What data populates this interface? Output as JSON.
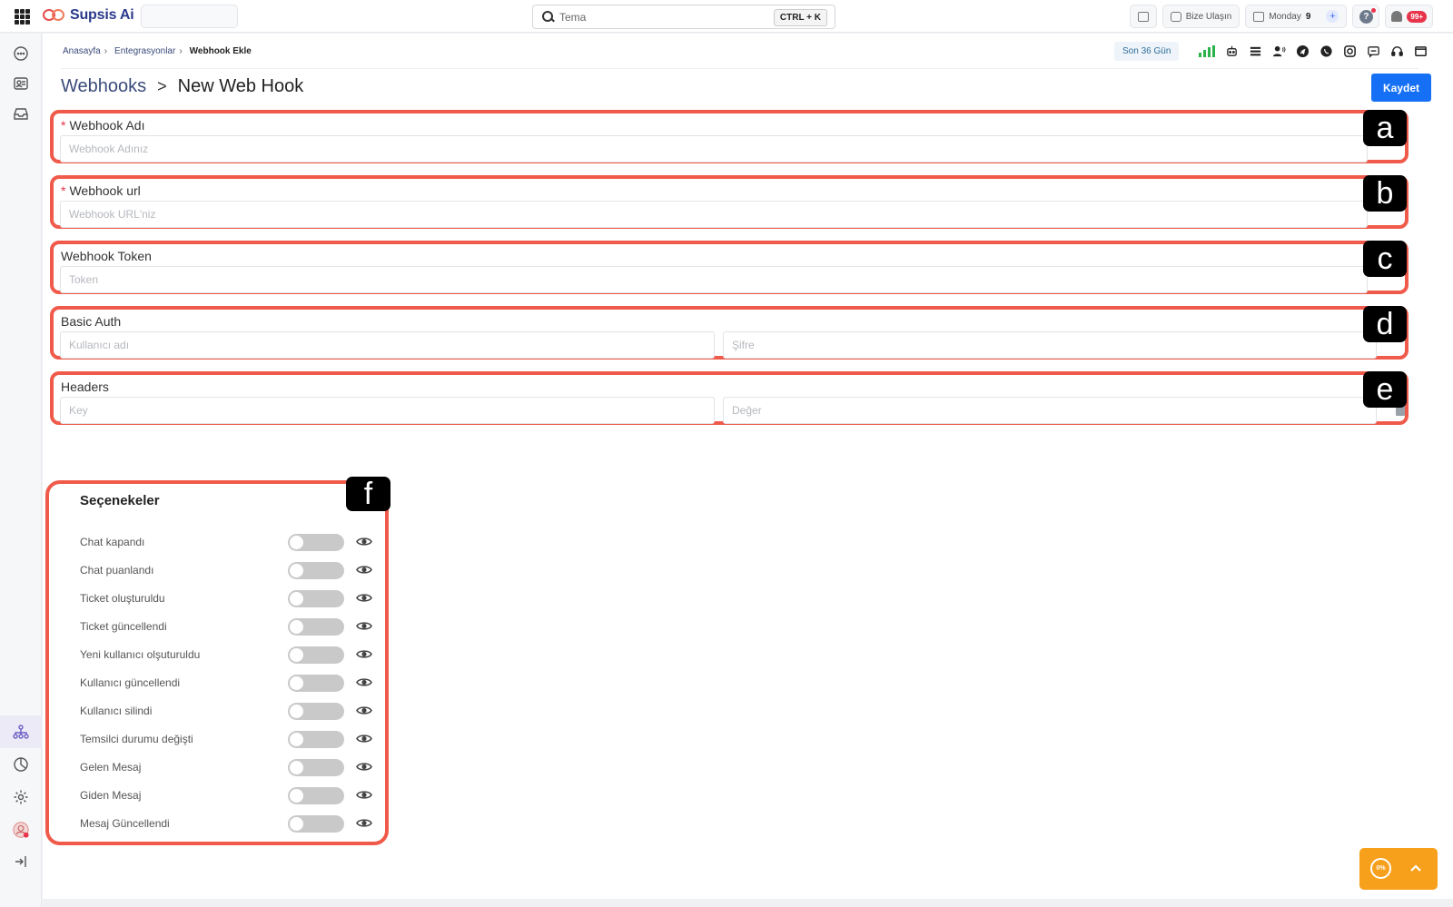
{
  "app": {
    "name": "Supsis Ai"
  },
  "search": {
    "value": "Tema",
    "shortcut": "CTRL + K"
  },
  "topbar": {
    "contact_label": "Bize Ulaşın",
    "date_day": "Monday",
    "date_num": "9",
    "notif_count": "99+",
    "help": "?"
  },
  "breadcrumb": {
    "items": [
      "Anasayfa",
      "Entegrasyonlar",
      "Webhook Ekle"
    ],
    "separator": "›"
  },
  "toolbar": {
    "period": "Son 36 Gün"
  },
  "page": {
    "parent": "Webhooks",
    "chevron": ">",
    "title": "New Web Hook",
    "save_label": "Kaydet"
  },
  "form": {
    "name": {
      "required": "*",
      "label": "Webhook Adı",
      "placeholder": "Webhook Adınız",
      "tag": "a"
    },
    "url": {
      "required": "*",
      "label": "Webhook url",
      "placeholder": "Webhook URL'niz",
      "tag": "b"
    },
    "token": {
      "label": "Webhook Token",
      "placeholder": "Token",
      "tag": "c"
    },
    "auth": {
      "label": "Basic Auth",
      "user_placeholder": "Kullanıcı adı",
      "pass_placeholder": "Şifre",
      "tag": "d"
    },
    "headers": {
      "label": "Headers",
      "key_placeholder": "Key",
      "value_placeholder": "Değer",
      "tag": "e"
    }
  },
  "options": {
    "title": "Seçenekeler",
    "tag": "f",
    "items": [
      {
        "label": "Chat kapandı",
        "enabled": false
      },
      {
        "label": "Chat puanlandı",
        "enabled": false
      },
      {
        "label": "Ticket oluşturuldu",
        "enabled": false
      },
      {
        "label": "Ticket güncellendi",
        "enabled": false
      },
      {
        "label": "Yeni kullanıcı olşuturuldu",
        "enabled": false
      },
      {
        "label": "Kullanıcı güncellendi",
        "enabled": false
      },
      {
        "label": "Kullanıcı silindi",
        "enabled": false
      },
      {
        "label": "Temsilci durumu değişti",
        "enabled": false
      },
      {
        "label": "Gelen Mesaj",
        "enabled": false
      },
      {
        "label": "Giden Mesaj",
        "enabled": false
      },
      {
        "label": "Mesaj Güncellendi",
        "enabled": false
      }
    ]
  },
  "widget": {
    "progress": "0%"
  },
  "colors": {
    "accent": "#1570f5",
    "annotation": "#f05a4a",
    "widget": "#f7a01c",
    "toggle_off": "#c9c9c9"
  }
}
